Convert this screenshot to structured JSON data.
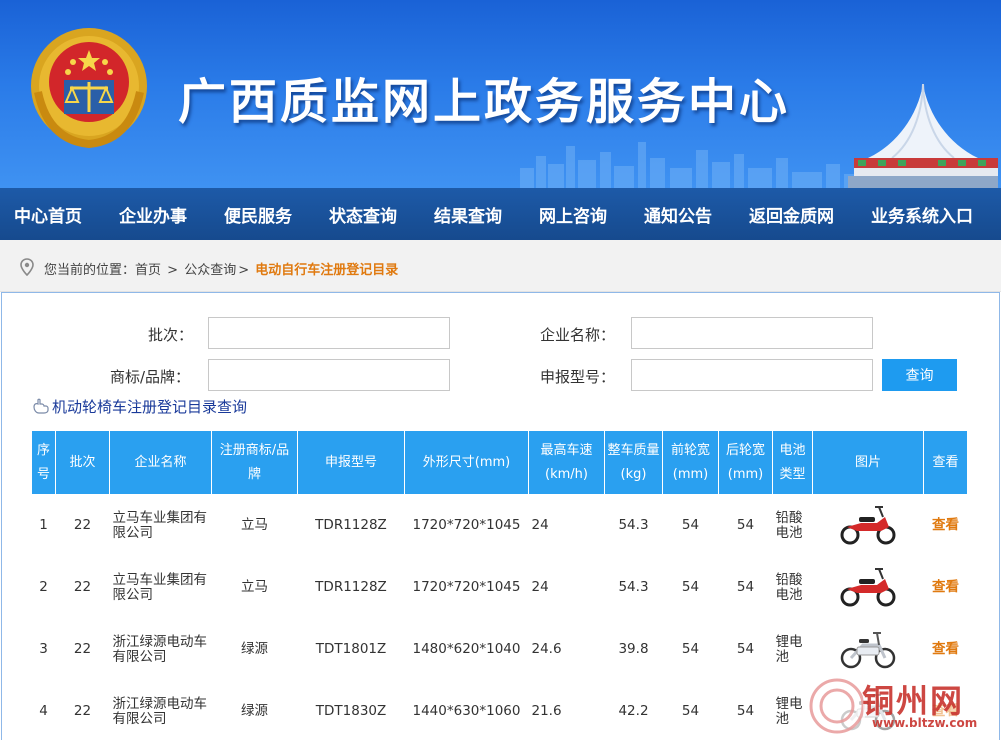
{
  "header": {
    "title": "广西质监网上政务服务中心"
  },
  "nav": {
    "items": [
      "中心首页",
      "企业办事",
      "便民服务",
      "状态查询",
      "结果查询",
      "网上咨询",
      "通知公告",
      "返回金质网",
      "业务系统入口"
    ]
  },
  "breadcrumb": {
    "prefix": "您当前的位置：",
    "home": "首页",
    "sep": ">",
    "level2": "公众查询",
    "current": "电动自行车注册登记目录"
  },
  "search": {
    "batch_label": "批次：",
    "batch_value": "",
    "company_label": "企业名称：",
    "company_value": "",
    "brand_label": "商标/品牌：",
    "brand_value": "",
    "model_label": "申报型号：",
    "model_value": "",
    "query_button": "查询",
    "wheelchair_link": "机动轮椅车注册登记目录查询"
  },
  "table": {
    "headers": [
      "序号",
      "批次",
      "企业名称",
      "注册商标/品牌",
      "申报型号",
      "外形尺寸(mm)",
      "最高车速(km/h)",
      "整车质量(kg)",
      "前轮宽(mm)",
      "后轮宽(mm)",
      "电池类型",
      "图片",
      "查看"
    ],
    "rows": [
      {
        "no": "1",
        "batch": "22",
        "company": "立马车业集团有限公司",
        "brand": "立马",
        "model": "TDR1128Z",
        "size": "1720*720*1045",
        "speed": "24",
        "mass": "54.3",
        "front": "54",
        "rear": "54",
        "battery": "铅酸电池",
        "image": "red-scooter-icon",
        "view": "查看"
      },
      {
        "no": "2",
        "batch": "22",
        "company": "立马车业集团有限公司",
        "brand": "立马",
        "model": "TDR1128Z",
        "size": "1720*720*1045",
        "speed": "24",
        "mass": "54.3",
        "front": "54",
        "rear": "54",
        "battery": "铅酸电池",
        "image": "red-scooter-icon",
        "view": "查看"
      },
      {
        "no": "3",
        "batch": "22",
        "company": "浙江绿源电动车有限公司",
        "brand": "绿源",
        "model": "TDT1801Z",
        "size": "1480*620*1040",
        "speed": "24.6",
        "mass": "39.8",
        "front": "54",
        "rear": "54",
        "battery": "锂电池",
        "image": "white-bicycle-icon",
        "view": "查看"
      },
      {
        "no": "4",
        "batch": "22",
        "company": "浙江绿源电动车有限公司",
        "brand": "绿源",
        "model": "TDT1830Z",
        "size": "1440*630*1060",
        "speed": "21.6",
        "mass": "42.2",
        "front": "54",
        "rear": "54",
        "battery": "锂电池",
        "image": "white-bicycle-icon",
        "view": "查看"
      }
    ]
  },
  "watermark": {
    "text": "铜州网",
    "url": "www.bltzw.com"
  },
  "colors": {
    "banner": "#2a7be8",
    "nav": "#1d5aa8",
    "table_header": "#2aa0f0",
    "accent_orange": "#e07a10",
    "button": "#1e9bf0"
  }
}
